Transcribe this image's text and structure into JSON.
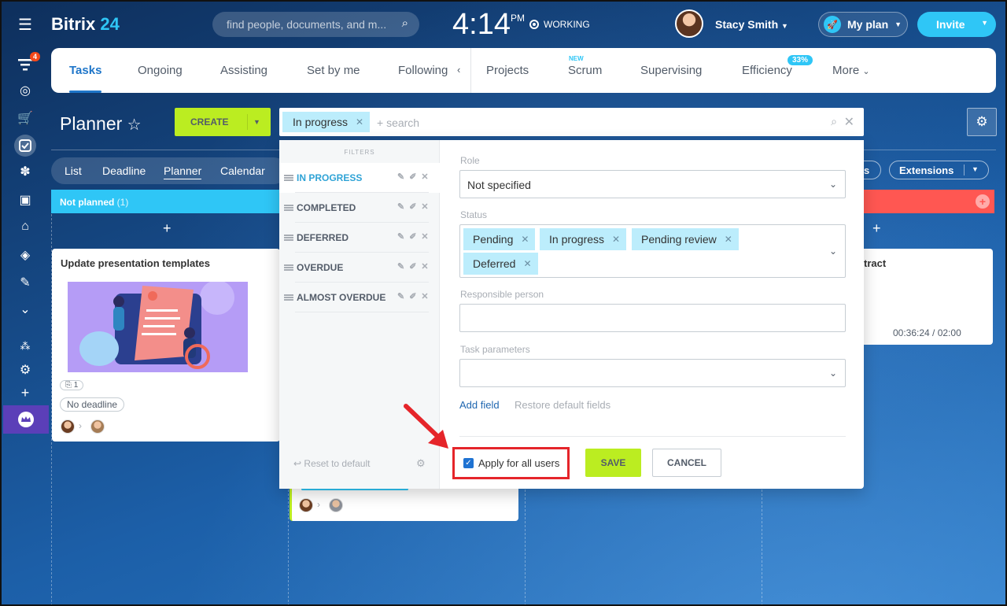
{
  "rail": {
    "badge": "4"
  },
  "header": {
    "logo_a": "Bitrix",
    "logo_b": "24",
    "search_placeholder": "find people, documents, and m...",
    "time": "4:14",
    "ampm": "PM",
    "status": "WORKING",
    "user_name": "Stacy Smith",
    "plan_label": "My plan",
    "invite_label": "Invite"
  },
  "tabs": {
    "items": [
      "Tasks",
      "Ongoing",
      "Assisting",
      "Set by me",
      "Following",
      "Projects",
      "Scrum",
      "Supervising",
      "Efficiency",
      "More"
    ],
    "new_tag": "NEW",
    "efficiency_badge": "33%"
  },
  "toolbar": {
    "title": "Planner",
    "create_label": "CREATE",
    "filter_chip": "In progress",
    "search_placeholder": "+ search"
  },
  "views": {
    "items": [
      "List",
      "Deadline",
      "Planner",
      "Calendar"
    ],
    "extensions": "Extensions",
    "stub": "s"
  },
  "columns": {
    "not_planned": "Not planned",
    "not_planned_count": "(1)"
  },
  "cards": {
    "card1_title": "Update presentation templates",
    "card1_counter": "1",
    "card1_deadline": "No deadline",
    "card3_title": "tract",
    "card3_timer": "00:36:24 / 02:00"
  },
  "filters": {
    "header": "FILTERS",
    "items": [
      "IN PROGRESS",
      "COMPLETED",
      "DEFERRED",
      "OVERDUE",
      "ALMOST OVERDUE"
    ],
    "reset": "Reset to default"
  },
  "form": {
    "role_label": "Role",
    "role_value": "Not specified",
    "status_label": "Status",
    "status_chips": [
      "Pending",
      "In progress",
      "Pending review",
      "Deferred"
    ],
    "responsible_label": "Responsible person",
    "params_label": "Task parameters",
    "add_field": "Add field",
    "restore_fields": "Restore default fields",
    "apply_all": "Apply for all users",
    "save": "SAVE",
    "cancel": "CANCEL"
  },
  "colors": {
    "accent": "#2fc6f6",
    "green": "#bbed21",
    "blue": "#1f76c9",
    "red": "#ff5752"
  }
}
